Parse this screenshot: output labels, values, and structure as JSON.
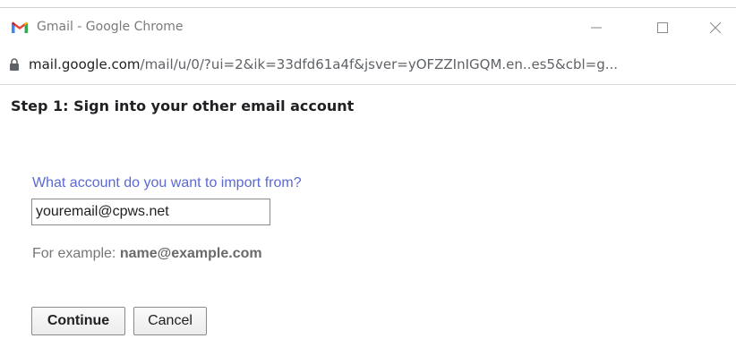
{
  "window": {
    "title": "Gmail - Google Chrome",
    "url_domain": "mail.google.com",
    "url_path": "/mail/u/0/?ui=2&ik=33dfd61a4f&jsver=yOFZZInIGQM.en..es5&cbl=g..."
  },
  "icons": {
    "app": "gmail-logo-icon",
    "lock": "lock-icon",
    "minimize": "minimize-icon",
    "maximize": "maximize-icon",
    "close": "close-icon"
  },
  "form": {
    "step_title": "Step 1: Sign into your other email account",
    "question": "What account do you want to import from?",
    "email_value": "youremail@cpws.net",
    "example_prefix": "For example: ",
    "example_value": "name@example.com",
    "continue_label": "Continue",
    "cancel_label": "Cancel"
  },
  "colors": {
    "question_text": "#5b69d6",
    "gmail_red": "#ea4335"
  }
}
